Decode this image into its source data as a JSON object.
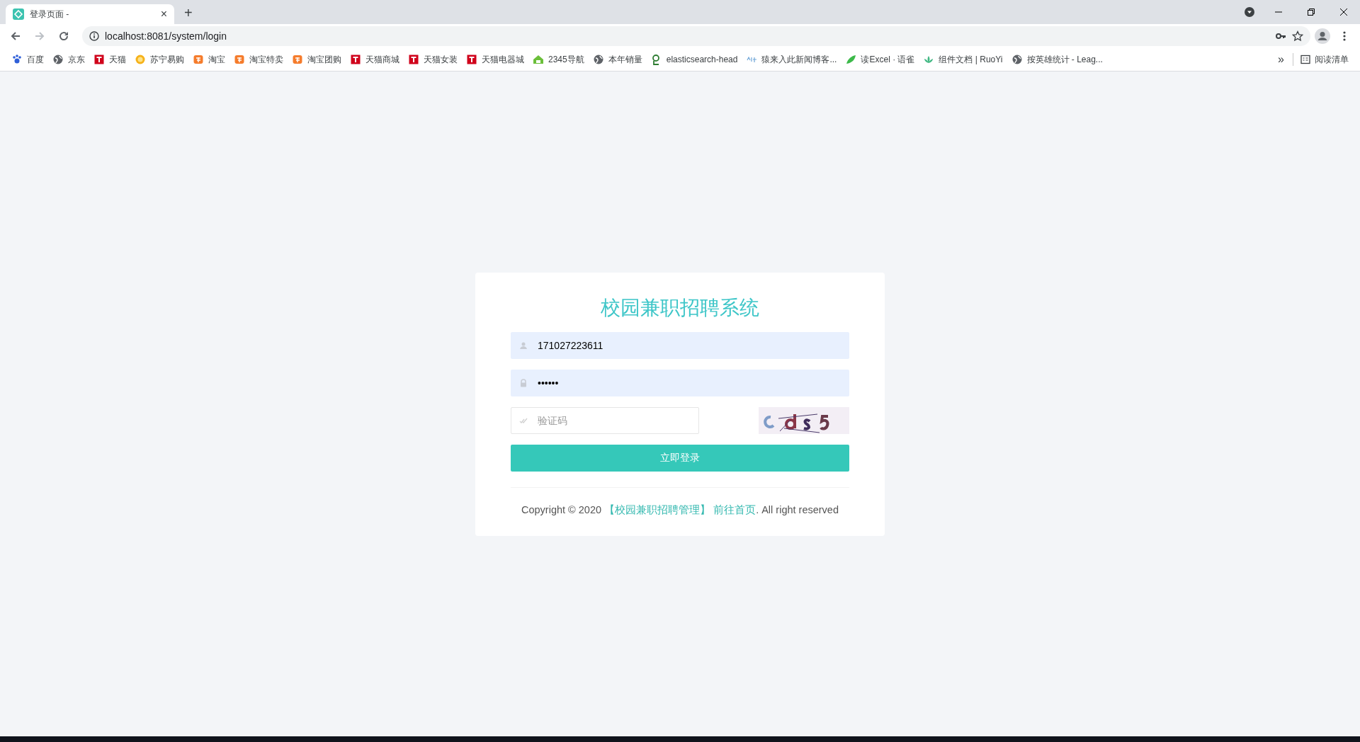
{
  "browser": {
    "tab": {
      "title": "登录页面 -",
      "close": "×",
      "selected": true
    },
    "new_tab": "+",
    "url": "localhost:8081/system/login",
    "bookmarks": [
      {
        "label": "百度",
        "kind": "paw"
      },
      {
        "label": "京东",
        "kind": "globe"
      },
      {
        "label": "天猫",
        "kind": "tmall"
      },
      {
        "label": "苏宁易购",
        "kind": "sun"
      },
      {
        "label": "淘宝",
        "kind": "taobao"
      },
      {
        "label": "淘宝特卖",
        "kind": "taobao"
      },
      {
        "label": "淘宝团购",
        "kind": "taobao"
      },
      {
        "label": "天猫商城",
        "kind": "tmall"
      },
      {
        "label": "天猫女装",
        "kind": "tmall"
      },
      {
        "label": "天猫电器城",
        "kind": "tmall"
      },
      {
        "label": "2345导航",
        "kind": "house"
      },
      {
        "label": "本年销量",
        "kind": "globe"
      },
      {
        "label": "elasticsearch-head",
        "kind": "elastic"
      },
      {
        "label": "猿来入此新闻博客...",
        "kind": "sketch"
      },
      {
        "label": "读Excel · 语雀",
        "kind": "bird"
      },
      {
        "label": "组件文档 | RuoYi",
        "kind": "lotus"
      },
      {
        "label": "按英雄统计 - Leag...",
        "kind": "globe"
      }
    ],
    "overflow": "»",
    "reading_list": "阅读清单"
  },
  "login": {
    "title": "校园兼职招聘系统",
    "username": "171027223611",
    "password": "••••••",
    "captcha_placeholder": "验证码",
    "submit": "立即登录",
    "footer": {
      "prefix": "Copyright © 2020 ",
      "link_system": "【校园兼职招聘管理】",
      "link_home": "前往首页",
      "suffix": ". All right reserved"
    }
  }
}
